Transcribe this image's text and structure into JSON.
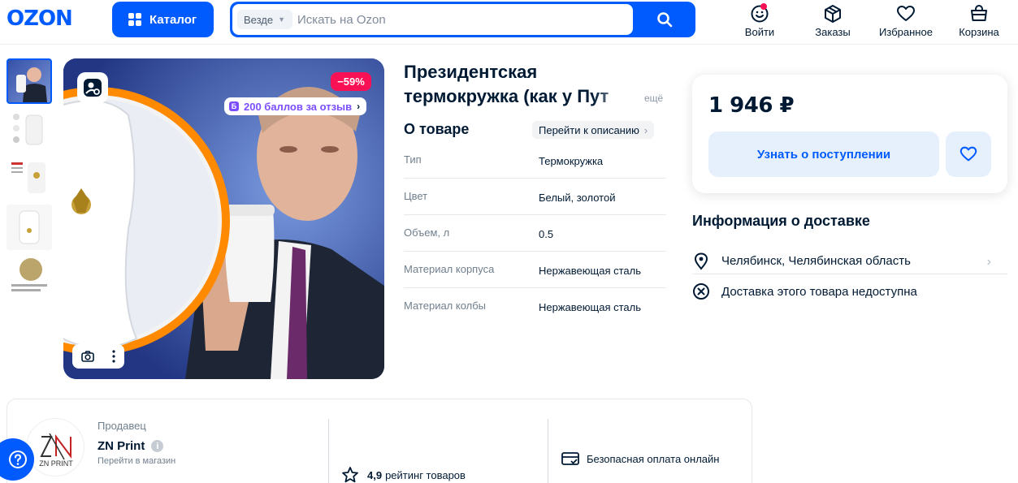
{
  "header": {
    "logo": "OZON",
    "catalog_label": "Каталог",
    "search_scope": "Везде",
    "search_placeholder": "Искать на Ozon",
    "nav": [
      {
        "label": "Войти",
        "icon": "smile-icon"
      },
      {
        "label": "Заказы",
        "icon": "box-icon"
      },
      {
        "label": "Избранное",
        "icon": "heart-icon"
      },
      {
        "label": "Корзина",
        "icon": "cart-icon"
      }
    ]
  },
  "gallery": {
    "discount_badge": "−59%",
    "points_badge_letter": "Б",
    "points_badge": "200 баллов за отзыв",
    "thumbnail_count": 5
  },
  "product": {
    "title_line1": "Президентская",
    "title_line2": "термокружка (как у Пут",
    "more_label": "ещё",
    "about_heading": "О товаре",
    "about_link": "Перейти к описанию",
    "specs": [
      {
        "key": "Тип",
        "value": "Термокружка"
      },
      {
        "key": "Цвет",
        "value": "Белый, золотой"
      },
      {
        "key": "Объем, л",
        "value": "0.5"
      },
      {
        "key": "Материал корпуса",
        "value": "Нержавеющая сталь"
      },
      {
        "key": "Материал колбы",
        "value": "Нержавеющая сталь"
      }
    ]
  },
  "buy": {
    "price": "1 946 ₽",
    "notify_label": "Узнать о поступлении"
  },
  "delivery": {
    "heading": "Информация о доставке",
    "city": "Челябинск, Челябинская область",
    "unavailable": "Доставка этого товара недоступна"
  },
  "seller": {
    "label": "Продавец",
    "name": "ZN Print",
    "info_glyph": "i",
    "link": "Перейти в магазин",
    "logo_text": "ZN PRINT",
    "rating_value": "4,9",
    "rating_label": "рейтинг товаров",
    "safe_payment": "Безопасная оплата онлайн"
  },
  "colors": {
    "brand": "#005bff",
    "discount": "#f91155",
    "points": "#7b4dff"
  }
}
